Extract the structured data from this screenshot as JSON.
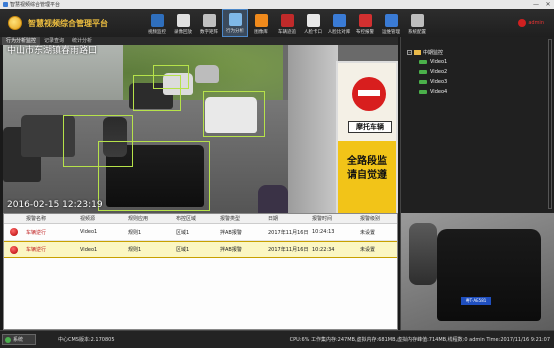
{
  "window": {
    "title": "智慧视频综合管理平台",
    "minimize": "—",
    "close": "✕"
  },
  "app": {
    "title": "智慧视频综合管理平台"
  },
  "toolbar": [
    {
      "label": "视频监控",
      "icon": "camera-icon",
      "color": "#2f6fbd"
    },
    {
      "label": "录像回放",
      "icon": "playback-icon",
      "color": "#e0e0e0"
    },
    {
      "label": "数字矩阵",
      "icon": "matrix-icon",
      "color": "#c0c0c0"
    },
    {
      "label": "行为分析",
      "icon": "behavior-analysis-icon",
      "color": "#7fb8e8"
    },
    {
      "label": "图像库",
      "icon": "image-library-icon",
      "color": "#f08a1c"
    },
    {
      "label": "车辆迹追",
      "icon": "vehicle-track-icon",
      "color": "#c02a2a"
    },
    {
      "label": "人脸卡口",
      "icon": "face-gate-icon",
      "color": "#e8e8e8"
    },
    {
      "label": "人脸比对库",
      "icon": "face-compare-icon",
      "color": "#3a7bd5"
    },
    {
      "label": "布控报警",
      "icon": "alarm-icon",
      "color": "#d23030"
    },
    {
      "label": "运维管理",
      "icon": "maintenance-icon",
      "color": "#3a7bd5"
    },
    {
      "label": "系统配置",
      "icon": "settings-icon",
      "color": "#bdbdbd"
    }
  ],
  "user": {
    "name": "admin"
  },
  "subtabs": [
    "行为分析监控",
    "记录查询",
    "统计分析"
  ],
  "video": {
    "location": "中山市东湖镇春雨路口",
    "timestamp": "2016-02-15  12:23:19",
    "sign_plate": "摩托车辆",
    "sign_text_1": "全路段监",
    "sign_text_2": "请自觉遵"
  },
  "tree": {
    "root": "中期监控",
    "cameras": [
      "Video1",
      "Video2",
      "Video3",
      "Video4"
    ]
  },
  "table": {
    "columns": [
      "",
      "报警名称",
      "视频源",
      "规则应用",
      "布控区域",
      "报警类型",
      "日期",
      "报警时间",
      "报警级别"
    ],
    "rows": [
      [
        "车辆逆行",
        "Video1",
        "规则1",
        "区域1",
        "拌AB报警",
        "2017年11月16日",
        "10:24:13",
        "未设置"
      ],
      [
        "车辆逆行",
        "Video1",
        "规则1",
        "区域1",
        "拌AB报警",
        "2017年11月16日",
        "10:22:34",
        "未设置"
      ]
    ]
  },
  "snapshot": {
    "plate": "粤T·AE581"
  },
  "status": {
    "start_label": "系统",
    "version": "中心CMS版本:2.170805",
    "sysinfo": "CPU:6%   工作集内存:247MB,虚拟内存:681MB,虚拟内存峰值:714MB,线程数:0     admin  Time:2017/11/16 9:21:07"
  }
}
